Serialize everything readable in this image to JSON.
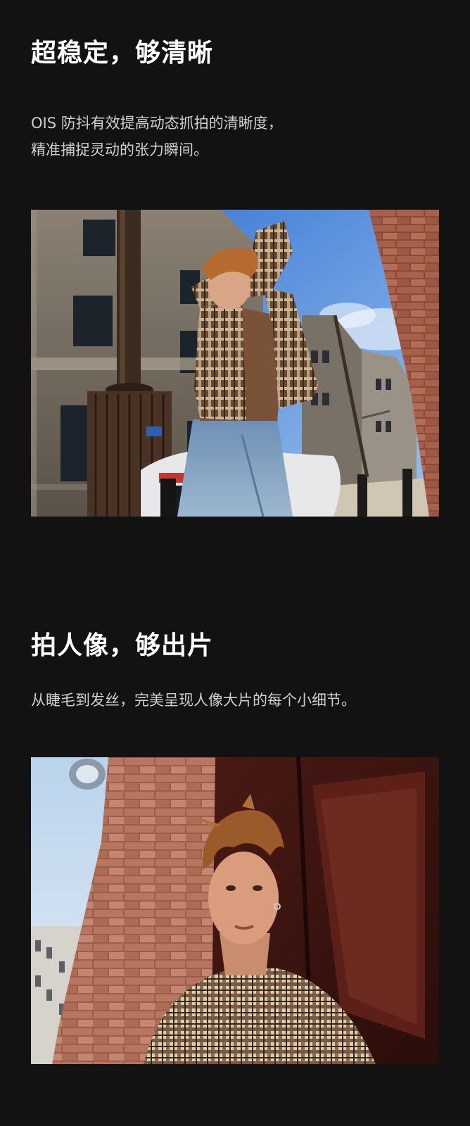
{
  "section_stabilization": {
    "title": "超稳定，够清晰",
    "line1": "OIS 防抖有效提高动态抓拍的清晰度，",
    "line2": "精准捕捉灵动的张力瞬间。"
  },
  "section_portrait": {
    "title": "拍人像，够出片",
    "line1": "从睫毛到发丝，完美呈现人像大片的每个小细节。"
  },
  "photos": {
    "street_photo_icon": "street-motion-photo",
    "portrait_photo_icon": "portrait-photo"
  }
}
